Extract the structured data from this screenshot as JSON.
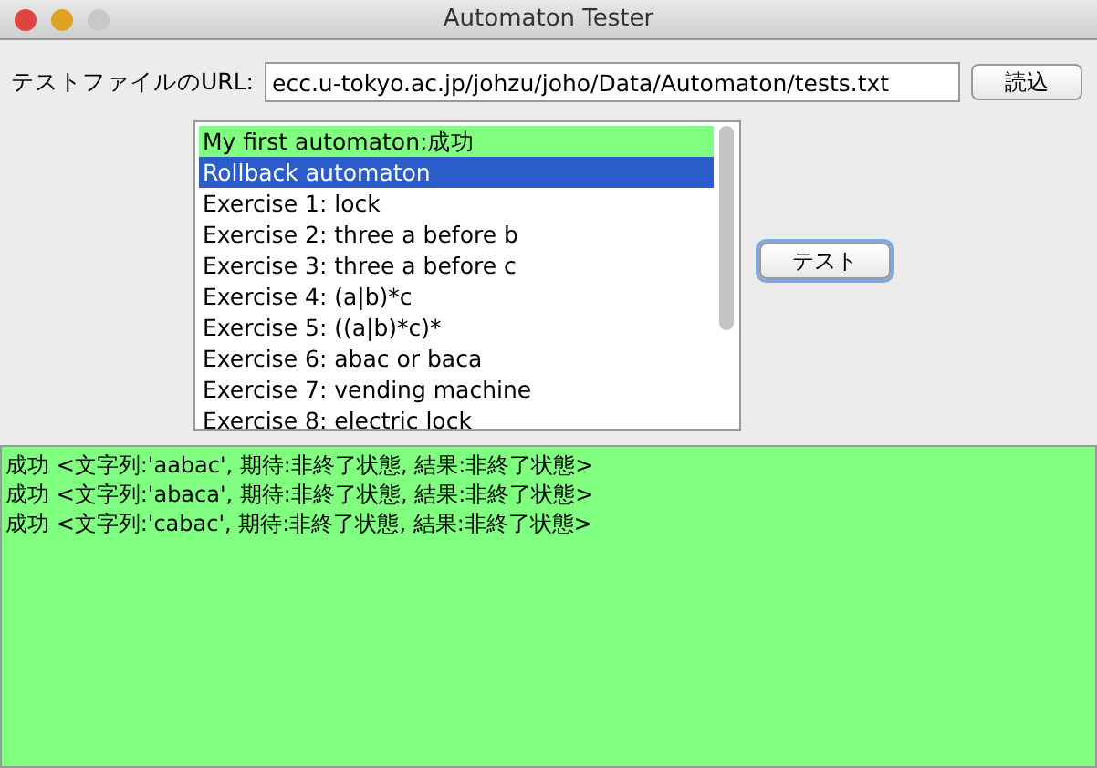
{
  "window": {
    "title": "Automaton Tester"
  },
  "url_label": "テストファイルのURL:",
  "url_field": {
    "value": "ecc.u-tokyo.ac.jp/johzu/joho/Data/Automaton/tests.txt"
  },
  "load_button": "読込",
  "automata": [
    {
      "label": "My first automaton:成功",
      "passed": true,
      "selected": false
    },
    {
      "label": "Rollback automaton",
      "passed": false,
      "selected": true
    },
    {
      "label": "Exercise 1: lock",
      "passed": false,
      "selected": false
    },
    {
      "label": "Exercise 2: three a before b",
      "passed": false,
      "selected": false
    },
    {
      "label": "Exercise 3: three a before c",
      "passed": false,
      "selected": false
    },
    {
      "label": "Exercise 4: (a|b)*c",
      "passed": false,
      "selected": false
    },
    {
      "label": "Exercise 5: ((a|b)*c)*",
      "passed": false,
      "selected": false
    },
    {
      "label": "Exercise 6: abac or baca",
      "passed": false,
      "selected": false
    },
    {
      "label": "Exercise 7: vending machine",
      "passed": false,
      "selected": false
    },
    {
      "label": "Exercise 8: electric lock",
      "passed": false,
      "selected": false
    }
  ],
  "test_button": "テスト",
  "results": {
    "passed": true,
    "lines": [
      "成功 <文字列:'aabac', 期待:非終了状態, 結果:非終了状態>",
      "成功 <文字列:'abaca', 期待:非終了状態, 結果:非終了状態>",
      "成功 <文字列:'cabac', 期待:非終了状態, 結果:非終了状態>"
    ]
  }
}
